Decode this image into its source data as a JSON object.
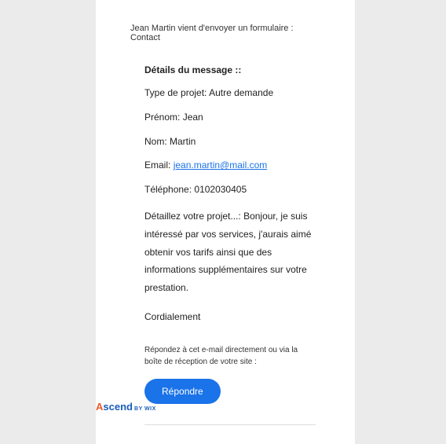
{
  "subject": "Jean Martin vient d'envoyer un formulaire : Contact",
  "details": {
    "heading": "Détails du message ::",
    "fields": {
      "type_label": "Type de projet:",
      "type_value": "Autre demande",
      "firstname_label": "Prénom:",
      "firstname_value": "Jean",
      "lastname_label": "Nom:",
      "lastname_value": "Martin",
      "email_label": "Email:",
      "email_value": "jean.martin@mail.com",
      "phone_label": "Téléphone:",
      "phone_value": "0102030405",
      "detail_label": "Détaillez votre projet...:",
      "detail_value": "Bonjour, je suis intéressé par vos services, j'aurais aimé obtenir vos tarifs ainsi que des informations supplémentaires sur votre prestation."
    },
    "signoff": "Cordialement"
  },
  "reply": {
    "hint": "Répondez à cet e-mail directement ou via la boîte de réception de votre site :",
    "button": "Répondre"
  },
  "brand": {
    "a": "A",
    "scend": "scend",
    "bywix": "BY WIX"
  }
}
